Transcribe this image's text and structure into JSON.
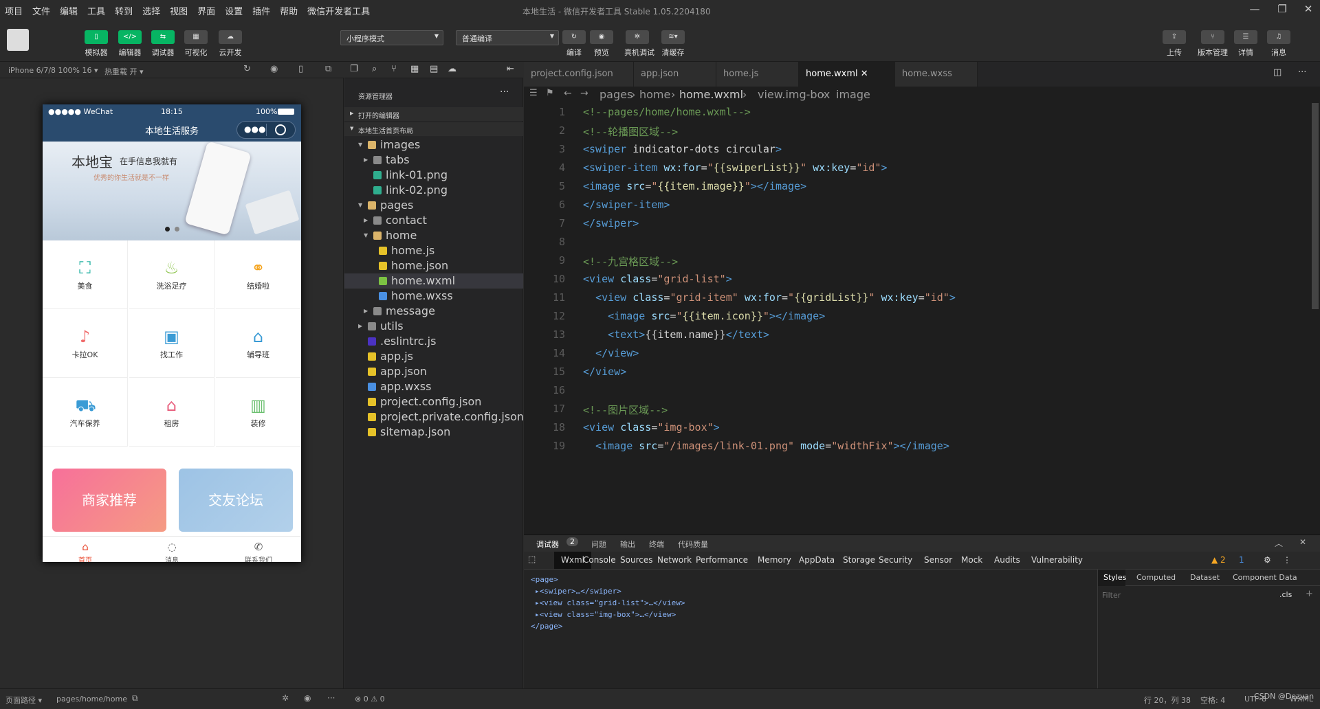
{
  "menubar": {
    "items": [
      "项目",
      "文件",
      "编辑",
      "工具",
      "转到",
      "选择",
      "视图",
      "界面",
      "设置",
      "插件",
      "帮助",
      "微信开发者工具"
    ]
  },
  "window": {
    "title": "本地生活 - 微信开发者工具 Stable 1.05.2204180"
  },
  "toolbar": {
    "simulator": "模拟器",
    "editor": "编辑器",
    "debugger": "调试器",
    "visual": "可视化",
    "cloud": "云开发",
    "mode_select": "小程序模式",
    "compile_select": "普通编译",
    "compile": "编译",
    "preview": "预览",
    "real_debug": "真机调试",
    "clear_cache": "清缓存",
    "upload": "上传",
    "version": "版本管理",
    "details": "详情",
    "messages": "消息"
  },
  "simbar": {
    "device": "iPhone 6/7/8 100% 16 ▾",
    "hotreload": "热重载 开 ▾"
  },
  "phone": {
    "carrier": "●●●●● WeChat",
    "time": "18:15",
    "battery": "100%",
    "nav_title": "本地生活服务",
    "banner_title": "本地宝",
    "banner_sub": "在手信息我就有",
    "banner_line": "优秀的你生活就是不一样",
    "grid": [
      {
        "name": "美食",
        "icon": "food-icon"
      },
      {
        "name": "洗浴足疗",
        "icon": "bath-icon"
      },
      {
        "name": "结婚啦",
        "icon": "wedding-icon"
      },
      {
        "name": "卡拉OK",
        "icon": "microphone-icon"
      },
      {
        "name": "找工作",
        "icon": "briefcase-icon"
      },
      {
        "name": "辅导班",
        "icon": "graduation-cap-icon"
      },
      {
        "name": "汽车保养",
        "icon": "car-wash-icon"
      },
      {
        "name": "租房",
        "icon": "house-icon"
      },
      {
        "name": "装修",
        "icon": "paint-roller-icon"
      }
    ],
    "img_left": "商家推荐",
    "img_right": "交友论坛",
    "tabs": [
      {
        "label": "首页",
        "active": true
      },
      {
        "label": "消息",
        "active": false
      },
      {
        "label": "联系我们",
        "active": false
      }
    ]
  },
  "explorer": {
    "title": "资源管理器",
    "open_editors": "打开的编辑器",
    "project": "本地生活首页布局",
    "tree": [
      {
        "name": "images",
        "type": "folder-open",
        "depth": 1
      },
      {
        "name": "tabs",
        "type": "folder",
        "depth": 2
      },
      {
        "name": "link-01.png",
        "type": "image",
        "depth": 2
      },
      {
        "name": "link-02.png",
        "type": "image",
        "depth": 2
      },
      {
        "name": "pages",
        "type": "folder-open",
        "depth": 1
      },
      {
        "name": "contact",
        "type": "folder",
        "depth": 2
      },
      {
        "name": "home",
        "type": "folder-open",
        "depth": 2
      },
      {
        "name": "home.js",
        "type": "js",
        "depth": 3
      },
      {
        "name": "home.json",
        "type": "json",
        "depth": 3
      },
      {
        "name": "home.wxml",
        "type": "wxml",
        "depth": 3,
        "selected": true
      },
      {
        "name": "home.wxss",
        "type": "wxss",
        "depth": 3
      },
      {
        "name": "message",
        "type": "folder",
        "depth": 2
      },
      {
        "name": "utils",
        "type": "folder",
        "depth": 1
      },
      {
        "name": ".eslintrc.js",
        "type": "eslint",
        "depth": 1
      },
      {
        "name": "app.js",
        "type": "js",
        "depth": 1
      },
      {
        "name": "app.json",
        "type": "json",
        "depth": 1
      },
      {
        "name": "app.wxss",
        "type": "wxss",
        "depth": 1
      },
      {
        "name": "project.config.json",
        "type": "json",
        "depth": 1
      },
      {
        "name": "project.private.config.json",
        "type": "json",
        "depth": 1
      },
      {
        "name": "sitemap.json",
        "type": "json",
        "depth": 1
      }
    ]
  },
  "editor": {
    "tabs": [
      {
        "label": "project.config.json",
        "active": false
      },
      {
        "label": "app.json",
        "active": false
      },
      {
        "label": "home.js",
        "active": false
      },
      {
        "label": "home.wxml",
        "active": true
      },
      {
        "label": "home.wxss",
        "active": false
      }
    ],
    "breadcrumb": [
      "pages",
      "home",
      "home.wxml",
      "view.img-box",
      "image"
    ],
    "lines": [
      "<!--pages/home/home.wxml-->",
      "<!--轮播图区域-->",
      "<swiper indicator-dots circular>",
      "<swiper-item wx:for=\"{{swiperList}}\" wx:key=\"id\">",
      "<image src=\"{{item.image}}\"></image>",
      "</swiper-item>",
      "</swiper>",
      "",
      "<!--九宫格区域-->",
      "<view class=\"grid-list\">",
      "  <view class=\"grid-item\" wx:for=\"{{gridList}}\" wx:key=\"id\">",
      "    <image src=\"{{item.icon}}\"></image>",
      "    <text>{{item.name}}</text>",
      "  </view>",
      "</view>",
      "",
      "<!--图片区域-->",
      "<view class=\"img-box\">",
      "  <image src=\"/images/link-01.png\" mode=\"widthFix\"></image>"
    ]
  },
  "devtools": {
    "top_tabs": [
      "调试器",
      "问题",
      "输出",
      "终端",
      "代码质量"
    ],
    "badge": "2",
    "tabs": [
      "Wxml",
      "Console",
      "Sources",
      "Network",
      "Performance",
      "Memory",
      "AppData",
      "Storage",
      "Security",
      "Sensor",
      "Mock",
      "Audits",
      "Vulnerability"
    ],
    "warn": "▲ 2",
    "info": "1",
    "dom": [
      "<page>",
      "▸<swiper>…</swiper>",
      "▸<view class=\"grid-list\">…</view>",
      "▸<view class=\"img-box\">…</view>",
      "</page>"
    ],
    "style_tabs": [
      "Styles",
      "Computed",
      "Dataset",
      "Component Data"
    ],
    "filter": "Filter",
    "cls": ".cls"
  },
  "status": {
    "path_label": "页面路径 ▾",
    "path": "pages/home/home",
    "errors": "⊗ 0 ⚠ 0",
    "cursor": "行 20，列 38",
    "spaces": "空格: 4",
    "encoding": "UTF-8",
    "lang": "WXML",
    "watermark": "CSDN @Dezyan"
  }
}
